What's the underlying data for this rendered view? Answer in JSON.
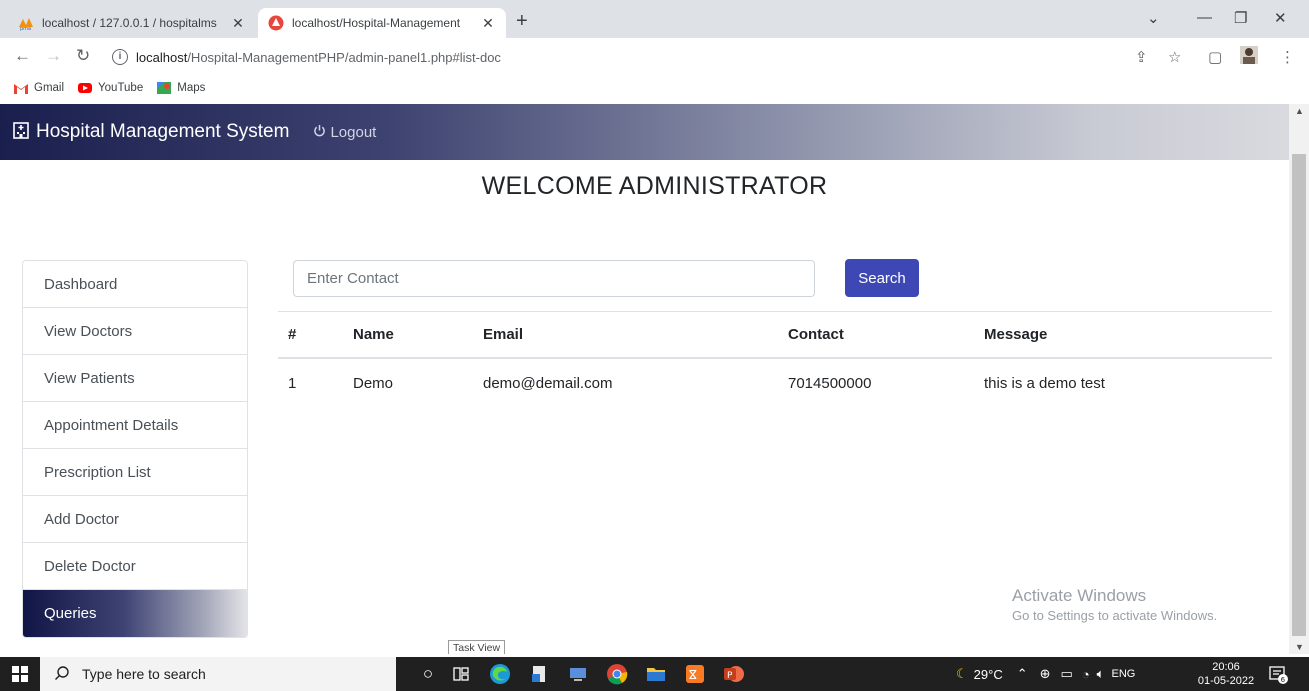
{
  "browser": {
    "tabs": [
      {
        "title": "localhost / 127.0.0.1 / hospitalms",
        "active": false
      },
      {
        "title": "localhost/Hospital-Management",
        "active": true
      }
    ],
    "url_host": "localhost",
    "url_path": "/Hospital-ManagementPHP/admin-panel1.php#list-doc",
    "bookmarks": [
      "Gmail",
      "YouTube",
      "Maps"
    ]
  },
  "navbar": {
    "brand": "Hospital Management System",
    "logout": "Logout"
  },
  "welcome": "WELCOME ADMINISTRATOR",
  "sidebar": {
    "items": [
      {
        "label": "Dashboard",
        "active": false
      },
      {
        "label": "View Doctors",
        "active": false
      },
      {
        "label": "View Patients",
        "active": false
      },
      {
        "label": "Appointment Details",
        "active": false
      },
      {
        "label": "Prescription List",
        "active": false
      },
      {
        "label": "Add Doctor",
        "active": false
      },
      {
        "label": "Delete Doctor",
        "active": false
      },
      {
        "label": "Queries",
        "active": true
      }
    ]
  },
  "search": {
    "placeholder": "Enter Contact",
    "button": "Search"
  },
  "table": {
    "headers": [
      "#",
      "Name",
      "Email",
      "Contact",
      "Message"
    ],
    "rows": [
      [
        "1",
        "Demo",
        "demo@demail.com",
        "7014500000",
        "this is a demo test"
      ]
    ]
  },
  "watermark": {
    "line1": "Activate Windows",
    "line2": "Go to Settings to activate Windows."
  },
  "tooltip": "Task View",
  "taskbar": {
    "search_placeholder": "Type here to search",
    "weather": "29°C",
    "lang": "ENG",
    "time": "20:06",
    "date": "01-05-2022",
    "notifications": "6"
  }
}
